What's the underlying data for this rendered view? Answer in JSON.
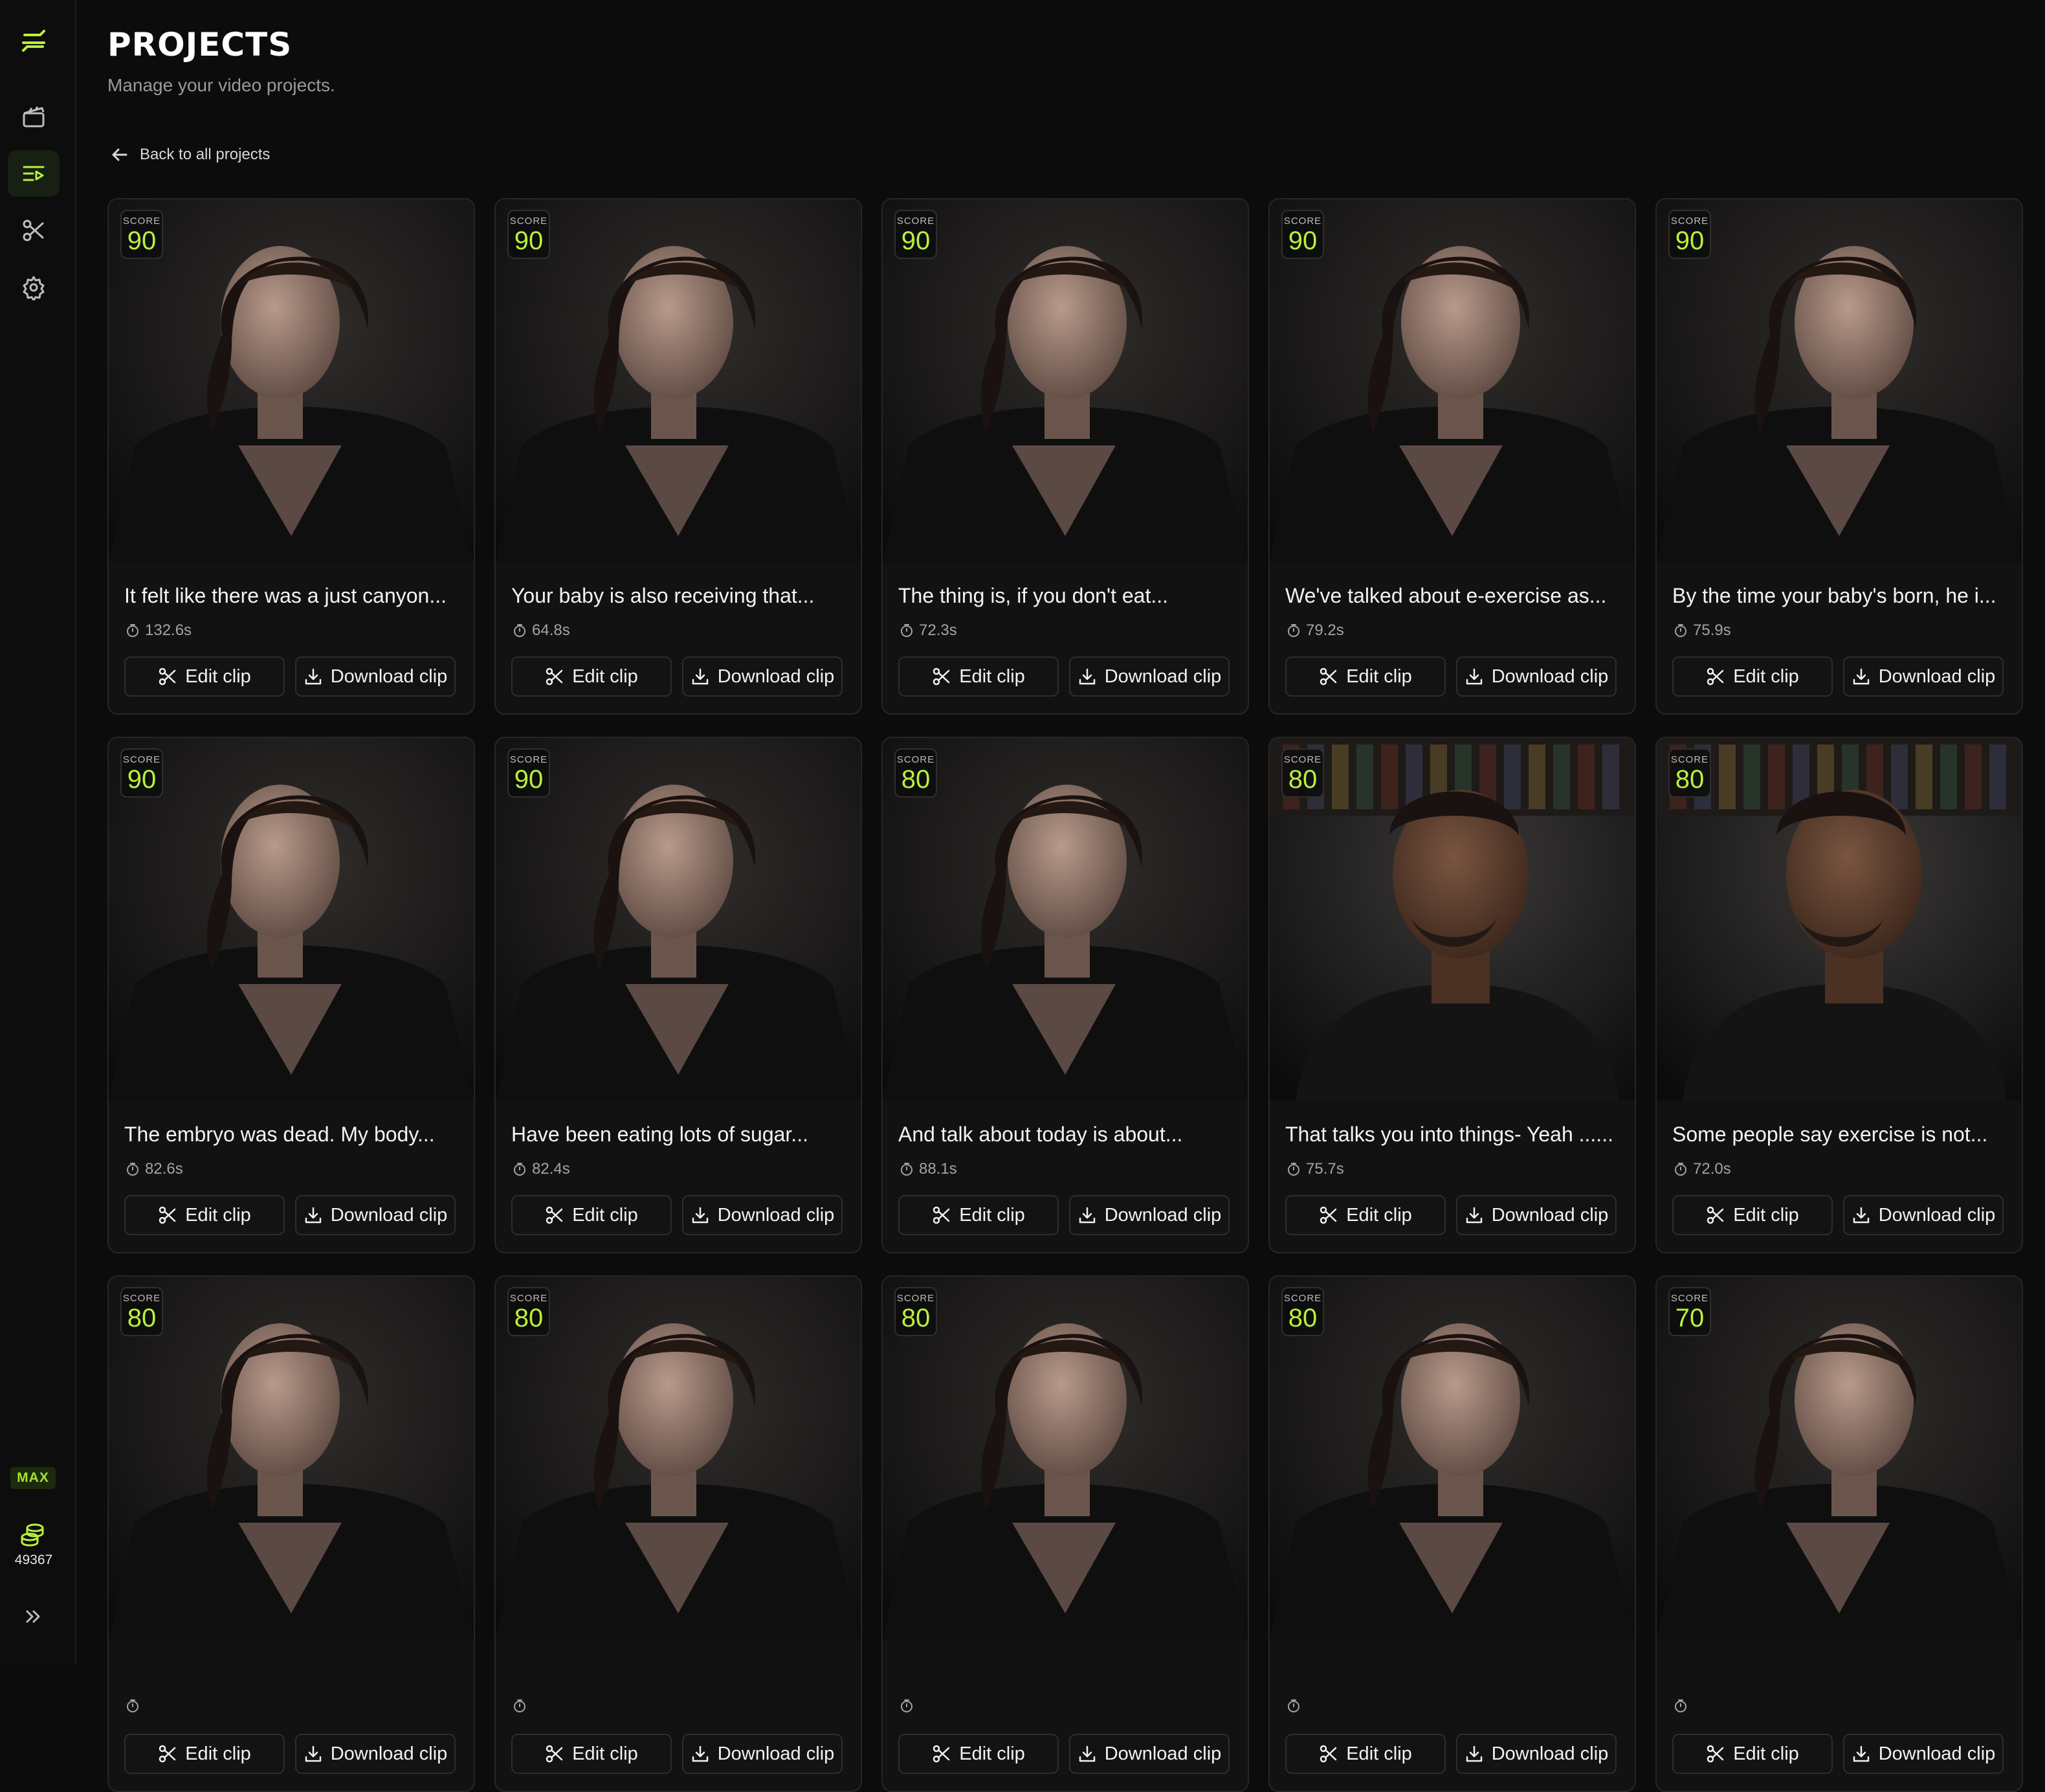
{
  "sidebar": {
    "items": [
      {
        "icon": "logo-icon"
      },
      {
        "icon": "clapperboard-icon"
      },
      {
        "icon": "clips-list-icon",
        "active": true
      },
      {
        "icon": "scissors-icon"
      },
      {
        "icon": "gear-icon"
      }
    ],
    "plan_badge": "MAX",
    "credits": "49367",
    "expand_icon": "double-chevron-right-icon"
  },
  "header": {
    "title": "PROJECTS",
    "subtitle": "Manage your video projects."
  },
  "back_link": {
    "label": "Back to all projects",
    "icon": "arrow-left-icon"
  },
  "labels": {
    "score": "SCORE",
    "edit": "Edit clip",
    "download": "Download clip"
  },
  "colors": {
    "accent": "#b8f23a",
    "background": "#0c0c0c",
    "card": "#121212"
  },
  "clips": [
    {
      "score": "90",
      "title": "It felt like there was a just canyon...",
      "duration": "132.6s",
      "subject": "woman"
    },
    {
      "score": "90",
      "title": "Your baby is also receiving that...",
      "duration": "64.8s",
      "subject": "woman"
    },
    {
      "score": "90",
      "title": "The thing is, if you don't eat...",
      "duration": "72.3s",
      "subject": "woman"
    },
    {
      "score": "90",
      "title": "We've talked about e-exercise as...",
      "duration": "79.2s",
      "subject": "woman"
    },
    {
      "score": "90",
      "title": "By the time your baby's born, he i...",
      "duration": "75.9s",
      "subject": "woman"
    },
    {
      "score": "90",
      "title": "The embryo was dead. My body...",
      "duration": "82.6s",
      "subject": "woman"
    },
    {
      "score": "90",
      "title": "Have been eating lots of sugar...",
      "duration": "82.4s",
      "subject": "woman"
    },
    {
      "score": "80",
      "title": "And talk about today is about...",
      "duration": "88.1s",
      "subject": "woman"
    },
    {
      "score": "80",
      "title": "That talks you into things- Yeah ......",
      "duration": "75.7s",
      "subject": "man"
    },
    {
      "score": "80",
      "title": "Some people say exercise is not...",
      "duration": "72.0s",
      "subject": "man"
    },
    {
      "score": "80",
      "title": "",
      "duration": "",
      "subject": "woman"
    },
    {
      "score": "80",
      "title": "",
      "duration": "",
      "subject": "woman"
    },
    {
      "score": "80",
      "title": "",
      "duration": "",
      "subject": "woman"
    },
    {
      "score": "80",
      "title": "",
      "duration": "",
      "subject": "woman"
    },
    {
      "score": "70",
      "title": "",
      "duration": "",
      "subject": "woman"
    }
  ]
}
